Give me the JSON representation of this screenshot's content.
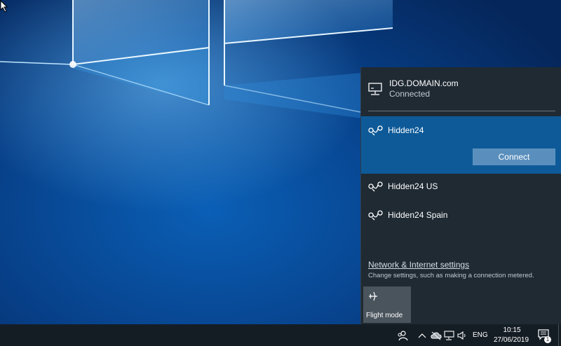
{
  "network_flyout": {
    "current_connection": {
      "name": "IDG.DOMAIN.com",
      "status": "Connected",
      "icon": "ethernet-icon"
    },
    "networks": [
      {
        "name": "Hidden24",
        "icon": "vpn-icon",
        "selected": true,
        "action_label": "Connect"
      },
      {
        "name": "Hidden24 US",
        "icon": "vpn-icon"
      },
      {
        "name": "Hidden24 Spain",
        "icon": "vpn-icon"
      }
    ],
    "settings_link": "Network & Internet settings",
    "settings_description": "Change settings, such as making a connection metered.",
    "quick_action": {
      "label": "Flight mode",
      "icon": "airplane-icon"
    }
  },
  "taskbar": {
    "language": "ENG",
    "time": "10:15",
    "date": "27/06/2019",
    "notification_count": "1",
    "tray_icons": [
      "people-icon",
      "chevron-up-icon",
      "cloud-icon",
      "network-icon",
      "volume-icon"
    ]
  },
  "colors": {
    "flyout_bg": "#1f2a33",
    "selected_bg": "#0e5a98",
    "connect_button": "#5a8fbd",
    "taskbar_bg": "#151d24"
  }
}
